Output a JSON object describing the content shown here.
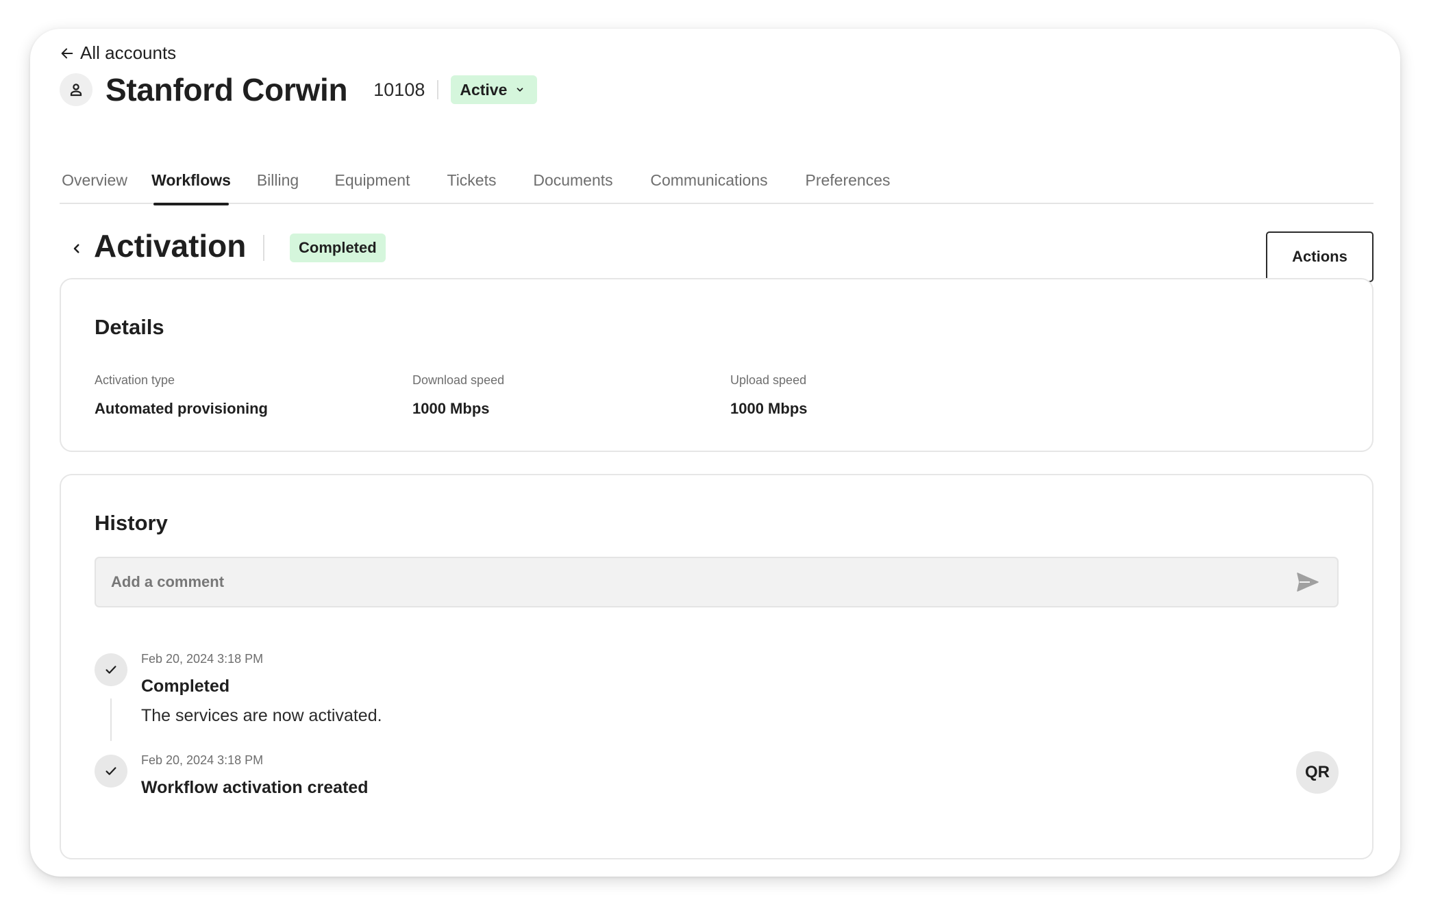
{
  "nav": {
    "back_label": "All accounts"
  },
  "account": {
    "name": "Stanford Corwin",
    "id": "10108",
    "status": "Active"
  },
  "tabs": [
    {
      "label": "Overview",
      "active": false
    },
    {
      "label": "Workflows",
      "active": true
    },
    {
      "label": "Billing",
      "active": false
    },
    {
      "label": "Equipment",
      "active": false
    },
    {
      "label": "Tickets",
      "active": false
    },
    {
      "label": "Documents",
      "active": false
    },
    {
      "label": "Communications",
      "active": false
    },
    {
      "label": "Preferences",
      "active": false
    }
  ],
  "workflow": {
    "title": "Activation",
    "status": "Completed",
    "actions_label": "Actions"
  },
  "details": {
    "title": "Details",
    "fields": [
      {
        "label": "Activation type",
        "value": "Automated provisioning"
      },
      {
        "label": "Download speed",
        "value": "1000 Mbps"
      },
      {
        "label": "Upload speed",
        "value": "1000 Mbps"
      }
    ]
  },
  "history": {
    "title": "History",
    "comment_placeholder": "Add a comment",
    "events": [
      {
        "time": "Feb 20, 2024 3:18 PM",
        "title": "Completed",
        "description": "The services are now activated."
      },
      {
        "time": "Feb 20, 2024 3:18 PM",
        "title": "Workflow activation created",
        "description": ""
      }
    ],
    "user_initials": "QR"
  },
  "colors": {
    "success_bg": "#d5f6dc",
    "text": "#1f1f1f",
    "muted": "#6e6e6e",
    "border": "#e6e6e6"
  },
  "icons": [
    "arrow-left-icon",
    "person-icon",
    "chevron-down-icon",
    "chevron-left-icon",
    "send-icon",
    "check-icon"
  ]
}
